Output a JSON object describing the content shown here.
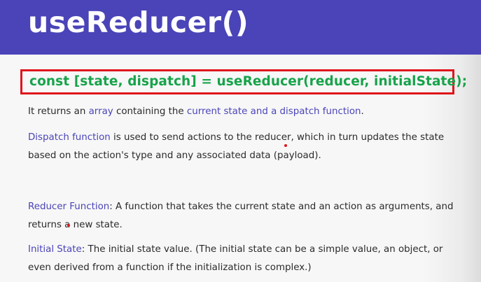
{
  "slide": {
    "title": "useReducer()",
    "code": "const [state, dispatch] = useReducer(reducer, initialState);",
    "p1": {
      "t1": "It returns an ",
      "h1": "array",
      "t2": " containing the ",
      "h2": "current state and a dispatch function",
      "t3": "."
    },
    "p2": {
      "h1": "Dispatch function",
      "t1": " is used to send actions to the reducer, which in turn updates the state based on the action's type and any associated data (payload)."
    },
    "p3": {
      "h1": "Reducer Function",
      "t1": ": A function that takes the current state and an action as arguments, and returns a new state."
    },
    "p4": {
      "h1": "Initial State",
      "t1": ": The initial state value. (The initial state can be a simple value, an object, or even derived from a function if the initialization is complex.)"
    }
  },
  "colors": {
    "header_bg": "#4a44b8",
    "accent_text": "#4a44b8",
    "code_text": "#17a34a",
    "highlight_border": "#e0151c"
  }
}
